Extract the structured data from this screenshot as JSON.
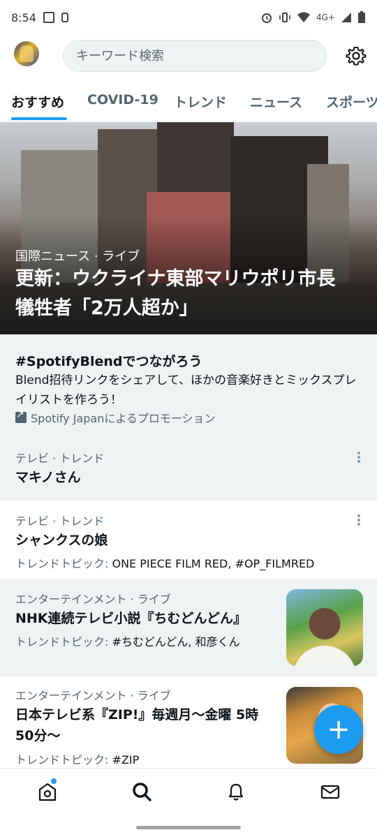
{
  "status_bar": {
    "time": "8:54",
    "network": "4G+"
  },
  "header": {
    "search_placeholder": "キーワード検索"
  },
  "tabs": [
    {
      "label": "おすすめ"
    },
    {
      "label": "COVID-19"
    },
    {
      "label": "トレンド"
    },
    {
      "label": "ニュース"
    },
    {
      "label": "スポーツ"
    }
  ],
  "hero": {
    "category": "国際ニュース · ライブ",
    "title": "更新：ウクライナ東部マリウポリ市長　犠牲者「2万人超か」"
  },
  "promo": {
    "title": "#SpotifyBlendでつながろう",
    "description": "Blend招待リンクをシェアして、ほかの音楽好きとミックスプレイリストを作ろう！",
    "promoted_by": "Spotify Japanによるプロモーション"
  },
  "trends": [
    {
      "category": "テレビ · トレンド",
      "title": "マキノさん"
    },
    {
      "category": "テレビ · トレンド",
      "title": "シャンクスの娘",
      "topic_label": "トレンドトピック: ",
      "topic_value": "ONE PIECE FILM RED, #OP_FILMRED"
    },
    {
      "category": "エンターテインメント · ライブ",
      "title": "NHK連続テレビ小説『ちむどんどん』",
      "topic_label": "トレンドトピック: ",
      "topic_value": "#ちむどんどん, 和彦くん"
    },
    {
      "category": "エンターテインメント · ライブ",
      "title": "日本テレビ系『ZIP!』毎週月～金曜 5時50分～",
      "topic_label": "トレンドトピック: ",
      "topic_value": "#ZIP"
    }
  ],
  "fab": {
    "label": "+"
  },
  "colors": {
    "accent": "#1d9bf0",
    "text_primary": "#0f1419",
    "text_secondary": "#536471",
    "highlight_bg": "#eff3f4"
  },
  "icons": {
    "nav": [
      "home-icon",
      "search-icon",
      "bell-icon",
      "mail-icon"
    ],
    "header": [
      "avatar",
      "gear-icon"
    ]
  }
}
